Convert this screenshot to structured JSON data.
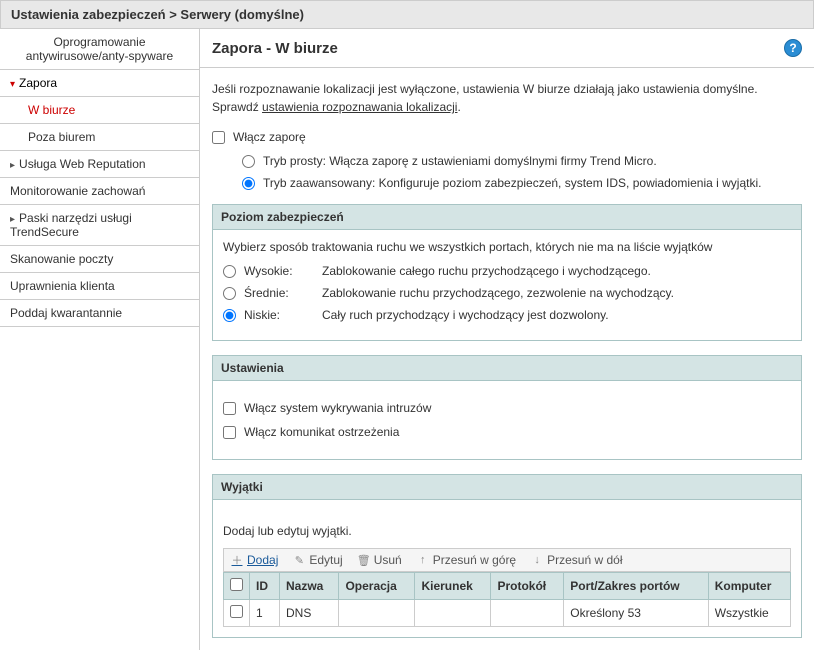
{
  "breadcrumb": "Ustawienia zabezpieczeń > Serwery (domyślne)",
  "sidebar": {
    "items": [
      {
        "label": "Oprogramowanie antywirusowe/anty-spyware"
      },
      {
        "label": "Zapora"
      },
      {
        "label": "W biurze"
      },
      {
        "label": "Poza biurem"
      },
      {
        "label": "Usługa Web Reputation"
      },
      {
        "label": "Monitorowanie zachowań"
      },
      {
        "label": "Paski narzędzi usługi TrendSecure"
      },
      {
        "label": "Skanowanie poczty"
      },
      {
        "label": "Uprawnienia klienta"
      },
      {
        "label": "Poddaj kwarantannie"
      }
    ]
  },
  "page": {
    "title": "Zapora - W biurze",
    "intro_line1": "Jeśli rozpoznawanie lokalizacji jest wyłączone, ustawienia W biurze działają jako ustawienia domyślne.",
    "intro_line2_prefix": "Sprawdź ",
    "intro_link": "ustawienia rozpoznawania lokalizacji",
    "intro_line2_suffix": ".",
    "enable_label": "Włącz zaporę",
    "mode_simple": "Tryb prosty: Włącza zaporę z ustawieniami domyślnymi firmy Trend Micro.",
    "mode_advanced": "Tryb zaawansowany: Konfiguruje poziom zabezpieczeń, system IDS, powiadomienia i wyjątki."
  },
  "security": {
    "header": "Poziom zabezpieczeń",
    "desc": "Wybierz sposób traktowania ruchu we wszystkich portach, których nie ma na liście wyjątków",
    "levels": [
      {
        "name": "Wysokie:",
        "desc": "Zablokowanie całego ruchu przychodzącego i wychodzącego."
      },
      {
        "name": "Średnie:",
        "desc": "Zablokowanie ruchu przychodzącego, zezwolenie na wychodzący."
      },
      {
        "name": "Niskie:",
        "desc": "Cały ruch przychodzący i wychodzący jest dozwolony."
      }
    ]
  },
  "settings": {
    "header": "Ustawienia",
    "ids": "Włącz system wykrywania intruzów",
    "warn": "Włącz komunikat ostrzeżenia"
  },
  "exceptions": {
    "header": "Wyjątki",
    "intro": "Dodaj lub edytuj wyjątki.",
    "toolbar": {
      "add": "Dodaj",
      "edit": "Edytuj",
      "delete": "Usuń",
      "up": "Przesuń w górę",
      "down": "Przesuń w dół"
    },
    "columns": {
      "id": "ID",
      "name": "Nazwa",
      "operation": "Operacja",
      "direction": "Kierunek",
      "protocol": "Protokół",
      "port": "Port/Zakres portów",
      "computer": "Komputer"
    },
    "rows": [
      {
        "id": "1",
        "name": "DNS",
        "operation": "",
        "direction": "",
        "protocol": "",
        "port": "Określony 53",
        "computer": "Wszystkie"
      }
    ]
  }
}
